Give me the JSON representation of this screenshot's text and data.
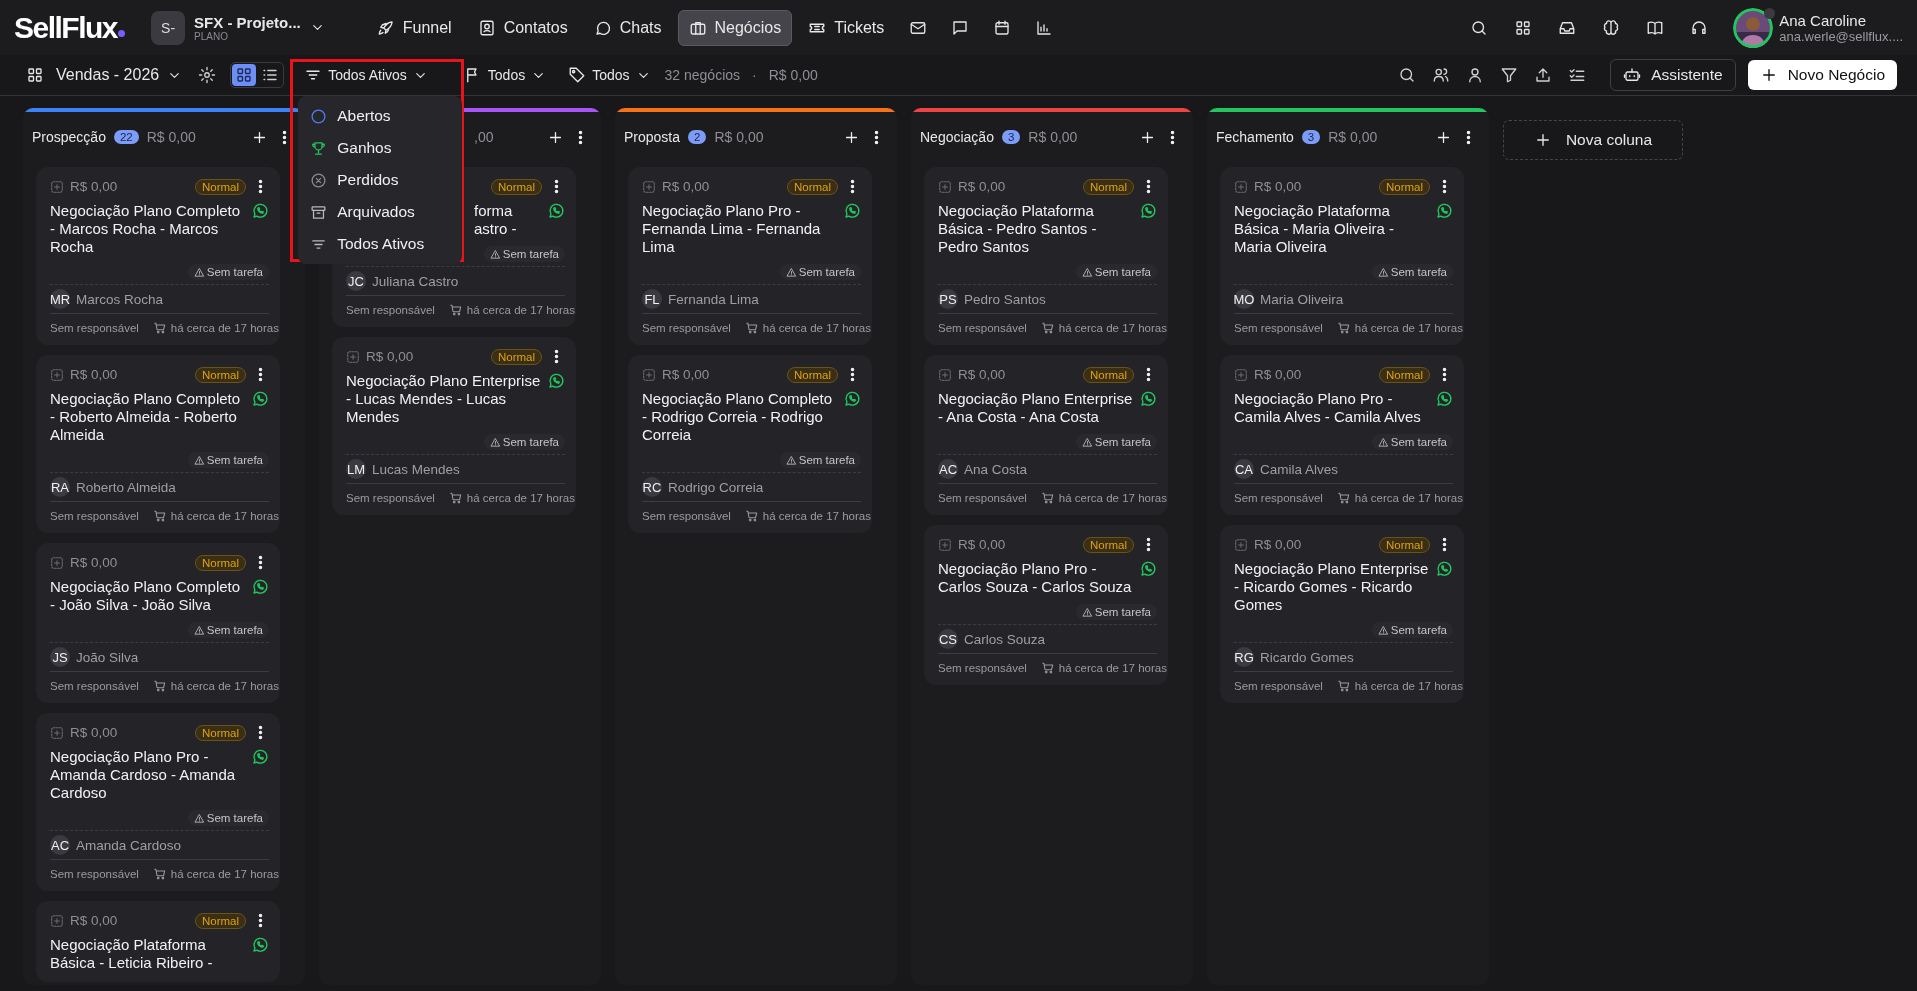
{
  "brand": {
    "name": "SellFlux"
  },
  "workspace": {
    "initials": "S-",
    "name": "SFX - Projeto...",
    "plan": "PLANO"
  },
  "nav": [
    {
      "label": "Funnel",
      "kind": "rocket",
      "selected": false
    },
    {
      "label": "Contatos",
      "kind": "contact",
      "selected": false
    },
    {
      "label": "Chats",
      "kind": "chat",
      "selected": false
    },
    {
      "label": "Negócios",
      "kind": "briefcase",
      "selected": true
    },
    {
      "label": "Tickets",
      "kind": "ticket",
      "selected": false
    }
  ],
  "user": {
    "name": "Ana Caroline",
    "email": "ana.werle@sellflux...."
  },
  "views": [
    {
      "kind": "grid",
      "selected": true
    },
    {
      "kind": "list",
      "selected": false
    }
  ],
  "toolbar": {
    "pipeline": "Vendas - 2026",
    "status_filter": "Todos Ativos",
    "owner_filter": "Todos",
    "tag_filter": "Todos",
    "count": "32 negócios",
    "separator": "·",
    "total": "R$ 0,00",
    "assistant": "Assistente",
    "new_deal": "Novo Negócio"
  },
  "status_menu": [
    {
      "label": "Abertos",
      "kind": "open"
    },
    {
      "label": "Ganhos",
      "kind": "won"
    },
    {
      "label": "Perdidos",
      "kind": "lost"
    },
    {
      "label": "Arquivados",
      "kind": "archived"
    },
    {
      "label": "Todos Ativos",
      "kind": "all"
    }
  ],
  "columns": [
    {
      "name": "Prospecção",
      "count": "22",
      "value": "R$ 0,00",
      "color": "#3b82f6",
      "cards": [
        {
          "value": "R$ 0,00",
          "priority": "Normal",
          "title": "Negociação Plano Completo - Marcos Rocha - Marcos Rocha",
          "task": "Sem tarefa",
          "initials": "MR",
          "contact": "Marcos Rocha",
          "owner": "Sem responsável",
          "time": "há cerca de 17 horas"
        },
        {
          "value": "R$ 0,00",
          "priority": "Normal",
          "title": "Negociação Plano Completo - Roberto Almeida - Roberto Almeida",
          "task": "Sem tarefa",
          "initials": "RA",
          "contact": "Roberto Almeida",
          "owner": "Sem responsável",
          "time": "há cerca de 17 horas"
        },
        {
          "value": "R$ 0,00",
          "priority": "Normal",
          "title": "Negociação Plano Completo - João Silva - João Silva",
          "task": "Sem tarefa",
          "initials": "JS",
          "contact": "João Silva",
          "owner": "Sem responsável",
          "time": "há cerca de 17 horas"
        },
        {
          "value": "R$ 0,00",
          "priority": "Normal",
          "title": "Negociação Plano Pro - Amanda Cardoso - Amanda Cardoso",
          "task": "Sem tarefa",
          "initials": "AC",
          "contact": "Amanda Cardoso",
          "owner": "Sem responsável",
          "time": "há cerca de 17 horas"
        },
        {
          "value": "R$ 0,00",
          "priority": "Normal",
          "title": "Negociação Plataforma Básica - Leticia Ribeiro -"
        }
      ]
    },
    {
      "value": ",00",
      "color": "#a855f7",
      "cards": [
        {
          "priority": "Normal",
          "title": "forma astro -",
          "task": "Sem tarefa",
          "initials": "JC",
          "contact": "Juliana Castro",
          "owner": "Sem responsável",
          "time": "há cerca de 17 horas"
        },
        {
          "value": "R$ 0,00",
          "priority": "Normal",
          "title": "Negociação Plano Enterprise - Lucas Mendes - Lucas Mendes",
          "task": "Sem tarefa",
          "initials": "LM",
          "contact": "Lucas Mendes",
          "owner": "Sem responsável",
          "time": "há cerca de 17 horas"
        }
      ]
    },
    {
      "name": "Proposta",
      "count": "2",
      "value": "R$ 0,00",
      "color": "#f97316",
      "cards": [
        {
          "value": "R$ 0,00",
          "priority": "Normal",
          "title": "Negociação Plano Pro - Fernanda Lima - Fernanda Lima",
          "task": "Sem tarefa",
          "initials": "FL",
          "contact": "Fernanda Lima",
          "owner": "Sem responsável",
          "time": "há cerca de 17 horas"
        },
        {
          "value": "R$ 0,00",
          "priority": "Normal",
          "title": "Negociação Plano Completo - Rodrigo Correia - Rodrigo Correia",
          "task": "Sem tarefa",
          "initials": "RC",
          "contact": "Rodrigo Correia",
          "owner": "Sem responsável",
          "time": "há cerca de 17 horas"
        }
      ]
    },
    {
      "name": "Negociação",
      "count": "3",
      "value": "R$ 0,00",
      "color": "#ef4444",
      "cards": [
        {
          "value": "R$ 0,00",
          "priority": "Normal",
          "title": "Negociação Plataforma Básica - Pedro Santos - Pedro Santos",
          "task": "Sem tarefa",
          "initials": "PS",
          "contact": "Pedro Santos",
          "owner": "Sem responsável",
          "time": "há cerca de 17 horas"
        },
        {
          "value": "R$ 0,00",
          "priority": "Normal",
          "title": "Negociação Plano Enterprise - Ana Costa - Ana Costa",
          "task": "Sem tarefa",
          "initials": "AC",
          "contact": "Ana Costa",
          "owner": "Sem responsável",
          "time": "há cerca de 17 horas"
        },
        {
          "value": "R$ 0,00",
          "priority": "Normal",
          "title": "Negociação Plano Pro - Carlos Souza - Carlos Souza",
          "task": "Sem tarefa",
          "initials": "CS",
          "contact": "Carlos Souza",
          "owner": "Sem responsável",
          "time": "há cerca de 17 horas"
        }
      ]
    },
    {
      "name": "Fechamento",
      "count": "3",
      "value": "R$ 0,00",
      "color": "#22c55e",
      "cards": [
        {
          "value": "R$ 0,00",
          "priority": "Normal",
          "title": "Negociação Plataforma Básica - Maria Oliveira - Maria Oliveira",
          "task": "Sem tarefa",
          "initials": "MO",
          "contact": "Maria Oliveira",
          "owner": "Sem responsável",
          "time": "há cerca de 17 horas"
        },
        {
          "value": "R$ 0,00",
          "priority": "Normal",
          "title": "Negociação Plano Pro - Camila Alves - Camila Alves",
          "task": "Sem tarefa",
          "initials": "CA",
          "contact": "Camila Alves",
          "owner": "Sem responsável",
          "time": "há cerca de 17 horas"
        },
        {
          "value": "R$ 0,00",
          "priority": "Normal",
          "title": "Negociação Plano Enterprise - Ricardo Gomes - Ricardo Gomes",
          "task": "Sem tarefa",
          "initials": "RG",
          "contact": "Ricardo Gomes",
          "owner": "Sem responsável",
          "time": "há cerca de 17 horas"
        }
      ]
    }
  ],
  "new_column": "Nova coluna"
}
